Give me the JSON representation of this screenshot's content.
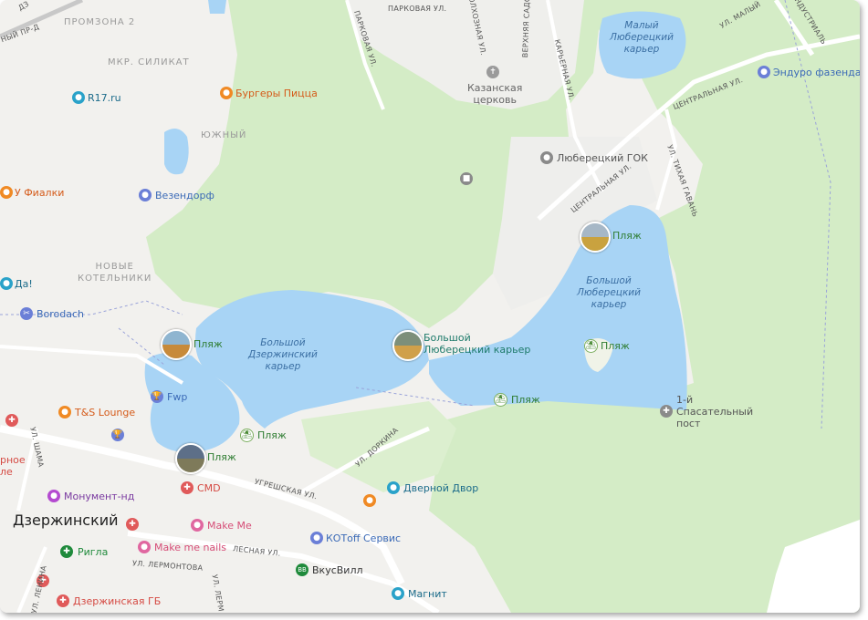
{
  "map": {
    "city": "Дзержинский",
    "lakes": {
      "small_lyuberetsky": "Малый\nЛюберецкий\nкарьер",
      "big_lyuberetsky_label": "Большой\nЛюберецкий\nкарьер",
      "big_dzerzhinsky_label": "Большой\nДзержинский\nкарьер",
      "big_lyuberetsky_poi": "Большой\nЛюберецкий карьер"
    },
    "districts": [
      "ПРОМЗОНА 2",
      "МКР. СИЛИКАТ",
      "ЮЖНЫЙ",
      "НОВЫЕ\nКОТЕЛЬНИКИ"
    ],
    "beaches": [
      "Пляж",
      "Пляж",
      "Пляж",
      "Пляж",
      "Пляж",
      "Пляж",
      "Пляж"
    ],
    "pois": {
      "burgers": "Бургеры Пицца",
      "r17": "R17.ru",
      "fialki": "У Фиалки",
      "vezendorf": "Везендорф",
      "da": "Да!",
      "borodach": "Borodach",
      "kazan_church": "Казанская\nцерковь",
      "gok": "Люберецкий ГОК",
      "enduro": "Эндуро фазенда",
      "fwp": "Fwp",
      "ts_lounge": "T&S Lounge",
      "spas_post": "1-й\nСпасательный\nпост",
      "dvernoy": "Дверной Двор",
      "monument": "Монумент-нд",
      "cmd": "CMD",
      "makeme": "Make Me",
      "makemenails": "Make me nails",
      "kotoff": "КОТoff Сервис",
      "vkusvill": "ВкусВилл",
      "rigla": "Ригла",
      "dzgb": "Дзержинская ГБ",
      "magnit": "Магнит",
      "partial_left": "рное\nле"
    },
    "streets": {
      "ugreshskaya": "УГРЕШСКАЯ УЛ.",
      "lesnaya": "ЛЕСНАЯ УЛ.",
      "lermontova": "УЛ. ЛЕРМОНТОВА",
      "lermontova2": "УЛ. ЛЕРМ",
      "dorkina": "УЛ. ДОРКИНА",
      "shama": "УЛ. ШАМА",
      "lenina": "УЛ. ЛЕНИНА",
      "parkovaya": "ПАРКОВАЯ УЛ.",
      "parkovaya2": "ПАРКОВАЯ УЛ.",
      "verkh_sadov": "ВЕРХНЯЯ САДОВ",
      "kolkhoz": "ОЛХОЗНАЯ УЛ.",
      "karernaya": "КАРЬЕРНАЯ УЛ.",
      "centralnaya": "ЦЕНТРАЛЬНАЯ УЛ.",
      "centralnaya2": "ЦЕНТРАЛЬНАЯ УЛ.",
      "tikhaya": "УЛ. ТИХАЯ ГАВАНЬ",
      "maliy": "УЛ. МАЛЫЙ",
      "industrial": "ИНДУСТРИАЛЬ",
      "nyi_pr": "НЫЙ ПР-Д",
      "dz": "ДЗ"
    },
    "colors": {
      "water": "#a8d4f5",
      "forest": "#d4ecc6",
      "land": "#f2f1ee",
      "road": "#ffffff",
      "beach_green": "#7bae5e"
    }
  }
}
